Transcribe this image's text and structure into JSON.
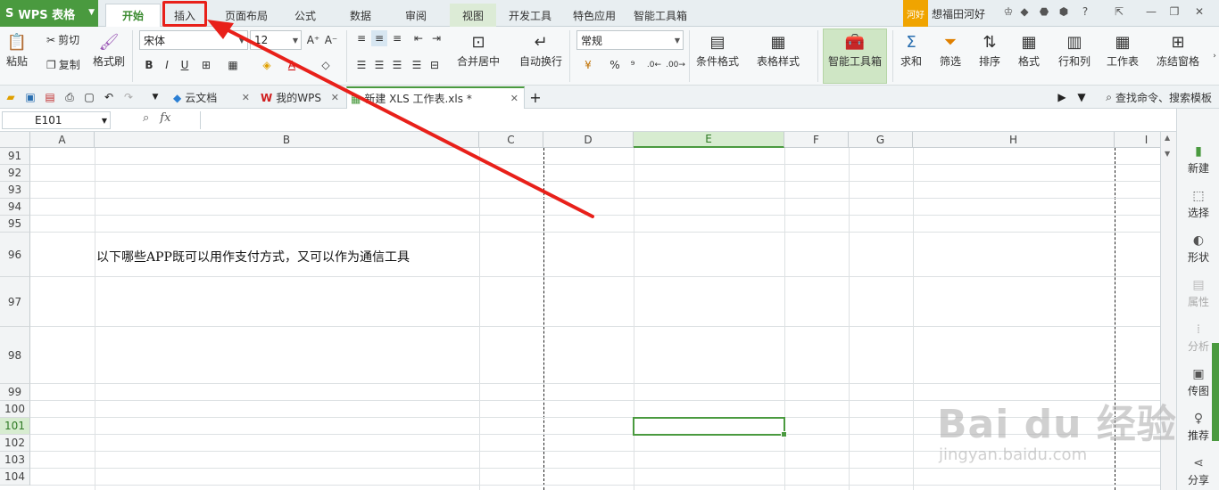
{
  "app": {
    "name": "WPS 表格",
    "logo": "S"
  },
  "menu_tabs": [
    {
      "label": "开始"
    },
    {
      "label": "插入"
    },
    {
      "label": "页面布局"
    },
    {
      "label": "公式"
    },
    {
      "label": "数据"
    },
    {
      "label": "审阅"
    },
    {
      "label": "视图"
    },
    {
      "label": "开发工具"
    },
    {
      "label": "特色应用"
    },
    {
      "label": "智能工具箱"
    }
  ],
  "user": {
    "badge": "河好",
    "name": "想福田河好"
  },
  "ribbon": {
    "paste": "粘贴",
    "cut": "剪切",
    "copy": "复制",
    "format_painter": "格式刷",
    "font_name": "宋体",
    "font_size": "12",
    "number_format": "常规",
    "merge_center": "合并居中",
    "wrap_text": "自动换行",
    "conditional_format": "条件格式",
    "table_style": "表格样式",
    "smart_toolbox": "智能工具箱",
    "sum": "求和",
    "filter": "筛选",
    "sort": "排序",
    "format": "格式",
    "row_col": "行和列",
    "worksheet": "工作表",
    "freeze": "冻结窗格",
    "bold": "B",
    "italic": "I",
    "underline": "U",
    "percent": "%",
    "comma": "⁹"
  },
  "doc_tabs": [
    {
      "label": "云文档"
    },
    {
      "label": "我的WPS"
    },
    {
      "label": "新建 XLS 工作表.xls *"
    }
  ],
  "search_cmd": "查找命令、搜索模板",
  "formula_bar": {
    "name_box": "E101",
    "fx": "fx",
    "value": ""
  },
  "columns": [
    "A",
    "B",
    "C",
    "D",
    "E",
    "F",
    "G",
    "H",
    "I"
  ],
  "selected_column": "E",
  "rows": [
    "91",
    "92",
    "93",
    "94",
    "95",
    "96",
    "97",
    "98",
    "99",
    "100",
    "101",
    "102",
    "103",
    "104"
  ],
  "selected_row": "101",
  "cell_text": "以下哪些APP既可以用作支付方式，又可以作为通信工具",
  "task_pane": [
    {
      "label": "新建",
      "icon": "new-file-icon"
    },
    {
      "label": "选择",
      "icon": "select-icon"
    },
    {
      "label": "形状",
      "icon": "shape-icon"
    },
    {
      "label": "属性",
      "icon": "properties-icon"
    },
    {
      "label": "分析",
      "icon": "analysis-icon"
    },
    {
      "label": "传图",
      "icon": "upload-image-icon"
    },
    {
      "label": "推荐",
      "icon": "recommend-icon"
    },
    {
      "label": "分享",
      "icon": "share-icon"
    }
  ],
  "watermark": {
    "main": "Bai du 经验",
    "sub": "jingyan.baidu.com"
  },
  "colors": {
    "accent": "#4a9a3f",
    "annotation": "#e8201a"
  }
}
